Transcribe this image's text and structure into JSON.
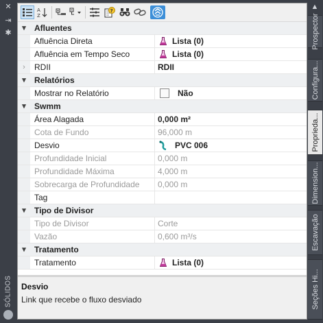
{
  "left_panel": {
    "label": "SÓLIDOS",
    "icons": [
      "close-icon",
      "pin-icon",
      "settings-icon"
    ]
  },
  "toolbar": {
    "buttons": [
      "categorized-icon",
      "alphabetical-sort-icon",
      "expand-all-icon",
      "collapse-all-icon",
      "property-list-icon",
      "help-icon",
      "binoculars-icon",
      "link-icon",
      "navigator-icon"
    ]
  },
  "grid": {
    "categories": {
      "afluentes": "Afluentes",
      "relatorios": "Relatórios",
      "swmm": "Swmm",
      "tipo_divisor": "Tipo de Divisor",
      "tratamento": "Tratamento"
    },
    "rows": {
      "afluencia_direta": {
        "name": "Afluência Direta",
        "value": "Lista (0)"
      },
      "afluencia_seco": {
        "name": "Afluência em Tempo Seco",
        "value": "Lista (0)"
      },
      "rdii": {
        "name": "RDII",
        "value": "RDII"
      },
      "mostrar": {
        "name": "Mostrar no Relatório",
        "value": "Não"
      },
      "area": {
        "name": "Área Alagada",
        "value": "0,000 m²"
      },
      "cota": {
        "name": "Cota de Fundo",
        "value": "96,000 m"
      },
      "desvio": {
        "name": "Desvio",
        "value": "PVC 006"
      },
      "prof_inicial": {
        "name": "Profundidade Inicial",
        "value": "0,000 m"
      },
      "prof_maxima": {
        "name": "Profundidade Máxima",
        "value": "4,000 m"
      },
      "sobrecarga": {
        "name": "Sobrecarga de Profundidade",
        "value": "0,000 m"
      },
      "tag": {
        "name": "Tag",
        "value": ""
      },
      "tipo": {
        "name": "Tipo de Divisor",
        "value": "Corte"
      },
      "vazao": {
        "name": "Vazão",
        "value": "0,600 m³/s"
      },
      "tratamento": {
        "name": "Tratamento",
        "value": "Lista (0)"
      }
    },
    "expand_glyph": "▾",
    "collapsed_glyph": "›"
  },
  "description": {
    "title": "Desvio",
    "text": "Link que recebe o fluxo desviado"
  },
  "right_tabs": [
    "Prospector",
    "Configura...",
    "Proprieda...",
    "Dimension...",
    "Escavação",
    "Seções Hi..."
  ],
  "colors": {
    "dark_bg": "#3b3f47",
    "category_bg": "#eef0f2",
    "flask": "#c2399a",
    "active_tab": "#e8e8e8",
    "selected_toolbar": "#3d8fd8"
  }
}
